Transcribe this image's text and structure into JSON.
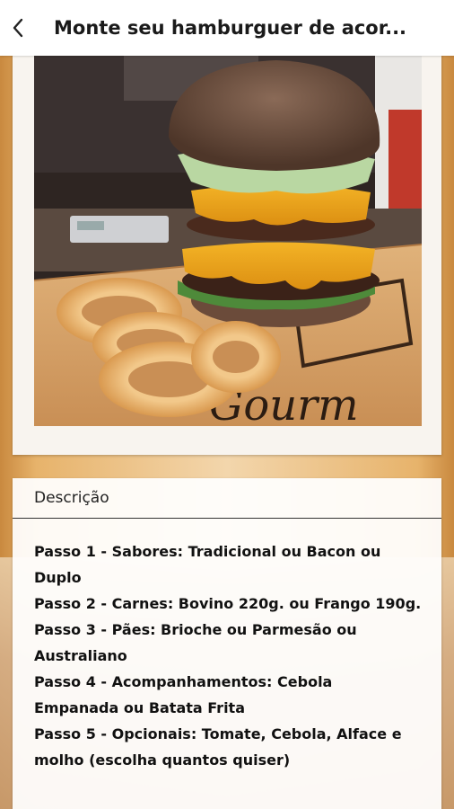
{
  "appbar": {
    "title": "Monte seu hamburguer de acor..."
  },
  "photo": {
    "alt": "burger-photo",
    "sign_text": "Gourm"
  },
  "description": {
    "header": "Descrição",
    "steps": [
      "Passo 1 - Sabores: Tradicional ou Bacon ou Duplo",
      "Passo 2 - Carnes: Bovino 220g. ou Frango 190g.",
      "Passo 3 - Pães: Brioche ou Parmesão ou Australiano",
      "Passo 4 - Acompanhamentos: Cebola Empanada ou Batata Frita",
      "Passo 5 - Opcionais: Tomate, Cebola, Alface e molho (escolha quantos quiser)"
    ]
  }
}
